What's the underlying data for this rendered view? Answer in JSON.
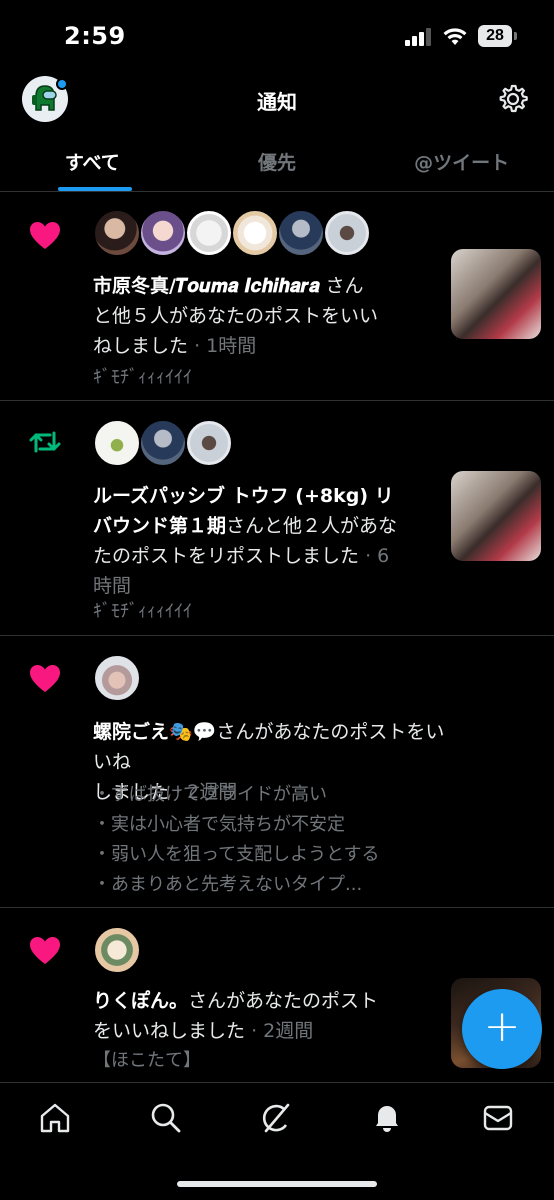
{
  "status_bar": {
    "time": "2:59",
    "battery": "28"
  },
  "header": {
    "title": "通知"
  },
  "tabs": [
    {
      "label": "すべて",
      "active": true
    },
    {
      "label": "優先",
      "active": false
    },
    {
      "label": "@ツイート",
      "active": false
    }
  ],
  "notifications": [
    {
      "type": "like",
      "icon": "heart-icon",
      "avatar_count": 6,
      "name": "市原冬真/𝑻𝒐𝒖𝒎𝒂 𝑰𝒄𝒉𝒊𝒉𝒂𝒓𝒂",
      "line1_rest": "さん",
      "line2": "と他５人があなたのポストをいい",
      "line3": "ねしました",
      "ago": "· 1時間",
      "preview": "ｷﾞﾓﾁﾞｨｨｨｲｲｲ"
    },
    {
      "type": "repost",
      "icon": "repost-icon",
      "avatar_count": 3,
      "line1": "ルーズパッシブ トウフ (+8kg) リ",
      "line2_name": "バウンド第１期",
      "line2_rest": "さんと他２人があな",
      "line3": "たのポストをリポストしました",
      "ago3": "· 6",
      "line4": "時間",
      "preview": "ｷﾞﾓﾁﾞｨｨｨｲｲｲ"
    },
    {
      "type": "like",
      "icon": "heart-icon",
      "avatar_count": 1,
      "name": "螺院ごえ🎭💬",
      "line1_rest": "さんがあなたのポストをいいね",
      "line2": "しました",
      "ago": "· 2週間",
      "preview_lines": [
        "・ずば抜けてプライドが高い",
        "・実は小心者で気持ちが不安定",
        "・弱い人を狙って支配しようとする",
        "・あまりあと先考えないタイプ..."
      ]
    },
    {
      "type": "like",
      "icon": "heart-icon",
      "avatar_count": 1,
      "name": "りくぽん。",
      "line1_rest": "さんがあなたのポスト",
      "line2": "をいいねしました",
      "ago": "· 2週間",
      "preview": "【ほこたて】"
    }
  ],
  "fab": {
    "label": "+"
  },
  "colors": {
    "accent": "#1d9bf0",
    "like": "#f91880",
    "repost": "#00ba7c",
    "background": "#000000"
  },
  "bottom_nav": [
    "home-icon",
    "search-icon",
    "grok-icon",
    "notifications-icon",
    "messages-icon"
  ]
}
